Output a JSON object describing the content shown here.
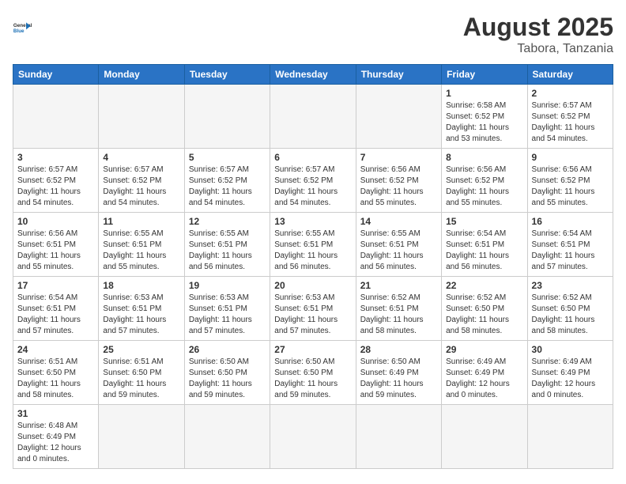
{
  "header": {
    "logo_general": "General",
    "logo_blue": "Blue",
    "month_title": "August 2025",
    "location": "Tabora, Tanzania"
  },
  "days_of_week": [
    "Sunday",
    "Monday",
    "Tuesday",
    "Wednesday",
    "Thursday",
    "Friday",
    "Saturday"
  ],
  "weeks": [
    [
      {
        "day": "",
        "info": ""
      },
      {
        "day": "",
        "info": ""
      },
      {
        "day": "",
        "info": ""
      },
      {
        "day": "",
        "info": ""
      },
      {
        "day": "",
        "info": ""
      },
      {
        "day": "1",
        "info": "Sunrise: 6:58 AM\nSunset: 6:52 PM\nDaylight: 11 hours\nand 53 minutes."
      },
      {
        "day": "2",
        "info": "Sunrise: 6:57 AM\nSunset: 6:52 PM\nDaylight: 11 hours\nand 54 minutes."
      }
    ],
    [
      {
        "day": "3",
        "info": "Sunrise: 6:57 AM\nSunset: 6:52 PM\nDaylight: 11 hours\nand 54 minutes."
      },
      {
        "day": "4",
        "info": "Sunrise: 6:57 AM\nSunset: 6:52 PM\nDaylight: 11 hours\nand 54 minutes."
      },
      {
        "day": "5",
        "info": "Sunrise: 6:57 AM\nSunset: 6:52 PM\nDaylight: 11 hours\nand 54 minutes."
      },
      {
        "day": "6",
        "info": "Sunrise: 6:57 AM\nSunset: 6:52 PM\nDaylight: 11 hours\nand 54 minutes."
      },
      {
        "day": "7",
        "info": "Sunrise: 6:56 AM\nSunset: 6:52 PM\nDaylight: 11 hours\nand 55 minutes."
      },
      {
        "day": "8",
        "info": "Sunrise: 6:56 AM\nSunset: 6:52 PM\nDaylight: 11 hours\nand 55 minutes."
      },
      {
        "day": "9",
        "info": "Sunrise: 6:56 AM\nSunset: 6:52 PM\nDaylight: 11 hours\nand 55 minutes."
      }
    ],
    [
      {
        "day": "10",
        "info": "Sunrise: 6:56 AM\nSunset: 6:51 PM\nDaylight: 11 hours\nand 55 minutes."
      },
      {
        "day": "11",
        "info": "Sunrise: 6:55 AM\nSunset: 6:51 PM\nDaylight: 11 hours\nand 55 minutes."
      },
      {
        "day": "12",
        "info": "Sunrise: 6:55 AM\nSunset: 6:51 PM\nDaylight: 11 hours\nand 56 minutes."
      },
      {
        "day": "13",
        "info": "Sunrise: 6:55 AM\nSunset: 6:51 PM\nDaylight: 11 hours\nand 56 minutes."
      },
      {
        "day": "14",
        "info": "Sunrise: 6:55 AM\nSunset: 6:51 PM\nDaylight: 11 hours\nand 56 minutes."
      },
      {
        "day": "15",
        "info": "Sunrise: 6:54 AM\nSunset: 6:51 PM\nDaylight: 11 hours\nand 56 minutes."
      },
      {
        "day": "16",
        "info": "Sunrise: 6:54 AM\nSunset: 6:51 PM\nDaylight: 11 hours\nand 57 minutes."
      }
    ],
    [
      {
        "day": "17",
        "info": "Sunrise: 6:54 AM\nSunset: 6:51 PM\nDaylight: 11 hours\nand 57 minutes."
      },
      {
        "day": "18",
        "info": "Sunrise: 6:53 AM\nSunset: 6:51 PM\nDaylight: 11 hours\nand 57 minutes."
      },
      {
        "day": "19",
        "info": "Sunrise: 6:53 AM\nSunset: 6:51 PM\nDaylight: 11 hours\nand 57 minutes."
      },
      {
        "day": "20",
        "info": "Sunrise: 6:53 AM\nSunset: 6:51 PM\nDaylight: 11 hours\nand 57 minutes."
      },
      {
        "day": "21",
        "info": "Sunrise: 6:52 AM\nSunset: 6:51 PM\nDaylight: 11 hours\nand 58 minutes."
      },
      {
        "day": "22",
        "info": "Sunrise: 6:52 AM\nSunset: 6:50 PM\nDaylight: 11 hours\nand 58 minutes."
      },
      {
        "day": "23",
        "info": "Sunrise: 6:52 AM\nSunset: 6:50 PM\nDaylight: 11 hours\nand 58 minutes."
      }
    ],
    [
      {
        "day": "24",
        "info": "Sunrise: 6:51 AM\nSunset: 6:50 PM\nDaylight: 11 hours\nand 58 minutes."
      },
      {
        "day": "25",
        "info": "Sunrise: 6:51 AM\nSunset: 6:50 PM\nDaylight: 11 hours\nand 59 minutes."
      },
      {
        "day": "26",
        "info": "Sunrise: 6:50 AM\nSunset: 6:50 PM\nDaylight: 11 hours\nand 59 minutes."
      },
      {
        "day": "27",
        "info": "Sunrise: 6:50 AM\nSunset: 6:50 PM\nDaylight: 11 hours\nand 59 minutes."
      },
      {
        "day": "28",
        "info": "Sunrise: 6:50 AM\nSunset: 6:49 PM\nDaylight: 11 hours\nand 59 minutes."
      },
      {
        "day": "29",
        "info": "Sunrise: 6:49 AM\nSunset: 6:49 PM\nDaylight: 12 hours\nand 0 minutes."
      },
      {
        "day": "30",
        "info": "Sunrise: 6:49 AM\nSunset: 6:49 PM\nDaylight: 12 hours\nand 0 minutes."
      }
    ],
    [
      {
        "day": "31",
        "info": "Sunrise: 6:48 AM\nSunset: 6:49 PM\nDaylight: 12 hours\nand 0 minutes."
      },
      {
        "day": "",
        "info": ""
      },
      {
        "day": "",
        "info": ""
      },
      {
        "day": "",
        "info": ""
      },
      {
        "day": "",
        "info": ""
      },
      {
        "day": "",
        "info": ""
      },
      {
        "day": "",
        "info": ""
      }
    ]
  ]
}
